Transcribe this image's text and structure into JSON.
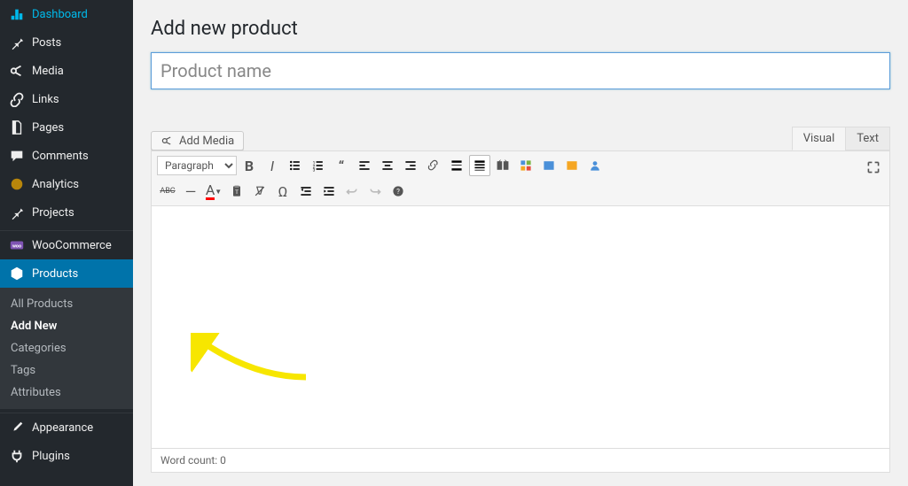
{
  "page": {
    "title": "Add new product"
  },
  "title_field": {
    "placeholder": "Product name",
    "value": ""
  },
  "sidebar": {
    "items": [
      {
        "label": "Dashboard",
        "icon": "dashboard"
      },
      {
        "label": "Posts",
        "icon": "pin"
      },
      {
        "label": "Media",
        "icon": "media"
      },
      {
        "label": "Links",
        "icon": "link"
      },
      {
        "label": "Pages",
        "icon": "page"
      },
      {
        "label": "Comments",
        "icon": "comment"
      },
      {
        "label": "Analytics",
        "icon": "globe"
      },
      {
        "label": "Projects",
        "icon": "pin"
      },
      {
        "label": "WooCommerce",
        "icon": "woo"
      },
      {
        "label": "Products",
        "icon": "products",
        "active": true
      },
      {
        "label": "Appearance",
        "icon": "brush"
      },
      {
        "label": "Plugins",
        "icon": "plug"
      }
    ],
    "submenu": [
      {
        "label": "All Products"
      },
      {
        "label": "Add New",
        "current": true
      },
      {
        "label": "Categories"
      },
      {
        "label": "Tags"
      },
      {
        "label": "Attributes"
      }
    ]
  },
  "editor": {
    "add_media": "Add Media",
    "tabs": {
      "visual": "Visual",
      "text": "Text"
    },
    "format_select": "Paragraph",
    "word_count_label": "Word count: 0"
  }
}
